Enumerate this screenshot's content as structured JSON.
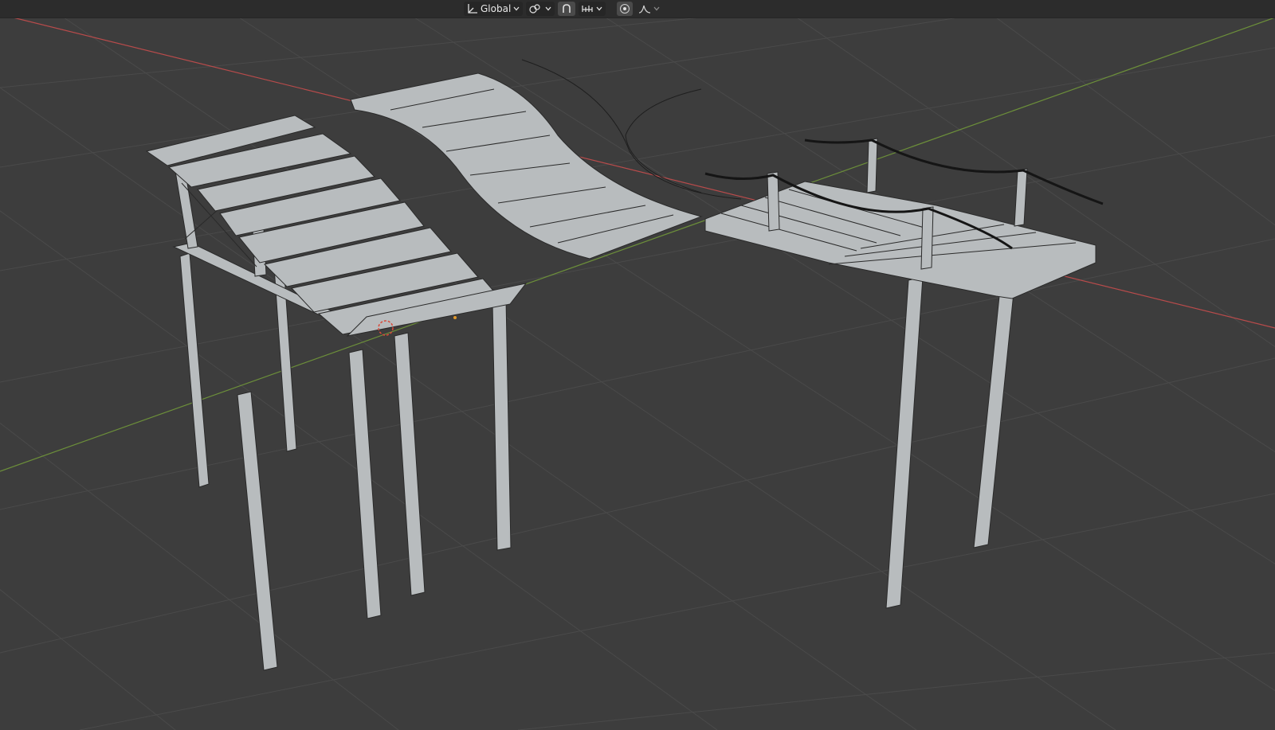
{
  "header": {
    "orientation_label": "Global",
    "icons": [
      "transform-orientation-icon",
      "chevron-down-icon",
      "transform-pivot-icon",
      "snap-magnet-icon",
      "snap-increment-icon",
      "proportional-editing-icon",
      "falloff-curve-icon"
    ]
  },
  "viewport": {
    "background": "#3d3d3d",
    "grid_color": "#4b4b4b",
    "x_axis_color": "#b84b4b",
    "y_axis_color": "#6c8f3a",
    "mesh_fill": "#b8bcbe",
    "wire_color": "#2a2a2a"
  }
}
